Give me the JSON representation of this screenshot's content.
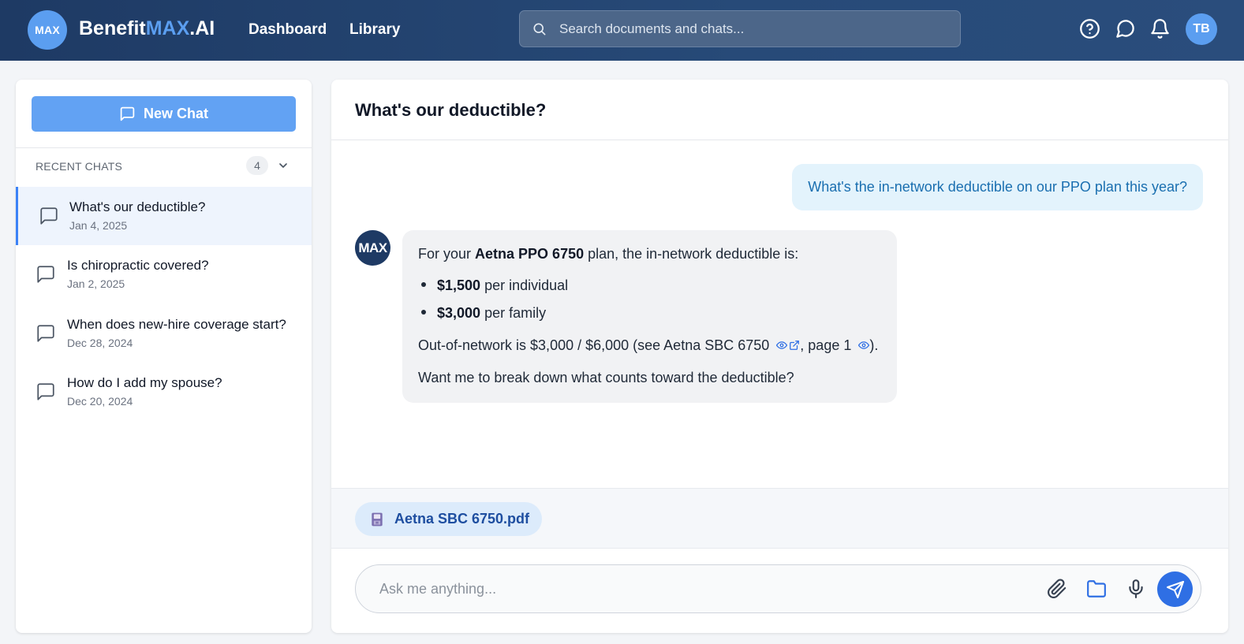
{
  "header": {
    "logo_badge": "MAX",
    "brand_prefix": "Benefit",
    "brand_accent": "MAX",
    "brand_suffix": ".AI",
    "nav": [
      "Dashboard",
      "Library"
    ],
    "search_placeholder": "Search documents and chats...",
    "icons": [
      "help-icon",
      "chat-icon",
      "bell-icon"
    ],
    "avatar_initials": "TB"
  },
  "sidebar": {
    "new_chat_label": "New Chat",
    "recent_title": "RECENT CHATS",
    "recent_count": "4",
    "chats": [
      {
        "title": "What's our deductible?",
        "date": "Jan 4, 2025",
        "active": true
      },
      {
        "title": "Is chiropractic covered?",
        "date": "Jan 2, 2025",
        "active": false
      },
      {
        "title": "When does new-hire coverage start?",
        "date": "Dec 28, 2024",
        "active": false
      },
      {
        "title": "How do I add my spouse?",
        "date": "Dec 20, 2024",
        "active": false
      }
    ]
  },
  "conversation": {
    "title": "What's our deductible?",
    "user_message": "What's the in-network deductible on our PPO plan this year?",
    "bot_avatar": "MAX",
    "bot_message": {
      "intro_prefix": "For your ",
      "intro_bold": "Aetna PPO 6750",
      "intro_suffix": " plan, the in-network deductible is:",
      "bullets": [
        {
          "bold": "$1,500",
          "text": " per individual"
        },
        {
          "bold": "$3,000",
          "text": " per family"
        }
      ],
      "oon_prefix": "Out-of-network is $3,000 / $6,000 (see Aetna SBC 6750",
      "oon_middle": ", page 1",
      "oon_suffix": ").",
      "followup": "Want me to break down what counts toward the deductible?"
    }
  },
  "attachment": {
    "file_name": "Aetna SBC 6750.pdf"
  },
  "composer": {
    "placeholder": "Ask me anything..."
  },
  "colors": {
    "header_bg": "#1e3a64",
    "accent": "#5b9ef0",
    "send_button": "#2f6fe4",
    "user_bubble": "#e3f3fc",
    "bot_bubble": "#f1f2f4"
  }
}
